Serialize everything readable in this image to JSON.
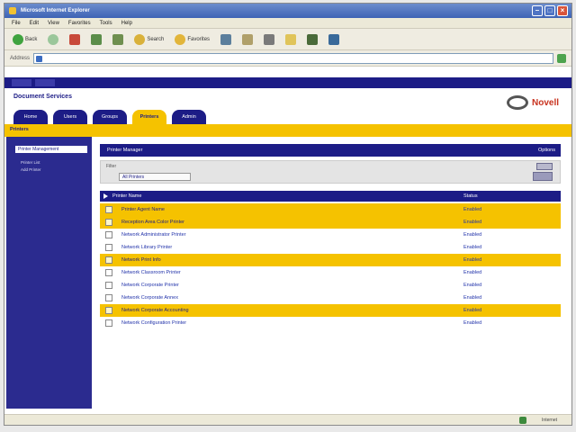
{
  "window": {
    "title": "Microsoft Internet Explorer"
  },
  "menu": [
    "File",
    "Edit",
    "View",
    "Favorites",
    "Tools",
    "Help"
  ],
  "toolbar": {
    "back": "Back",
    "search": "Search",
    "favorites": "Favorites"
  },
  "address": {
    "label": "Address"
  },
  "app": {
    "title": "Document Services",
    "logo_text": "Novell",
    "tabs": [
      "Home",
      "Users",
      "Groups",
      "Printers",
      "Admin"
    ],
    "active_tab": 3,
    "breadcrumb": "Printers"
  },
  "sidebar": {
    "heading": "Printer Management",
    "links": [
      "Printer List",
      "Add Printer"
    ]
  },
  "panel": {
    "title": "Printer Manager",
    "right_label": "Options",
    "filter_label": "Filter",
    "filter_value": "All Printers"
  },
  "list": {
    "col_name": "Printer Name",
    "col_status": "Status",
    "rows": [
      {
        "name": "Printer Agent Name",
        "status": "Enabled",
        "highlight": true
      },
      {
        "name": "Reception Area Color Printer",
        "status": "Enabled",
        "highlight": true
      },
      {
        "name": "Network Administrator Printer",
        "status": "Enabled",
        "highlight": false
      },
      {
        "name": "Network Library Printer",
        "status": "Enabled",
        "highlight": false
      },
      {
        "name": "Network Print Info",
        "status": "Enabled",
        "highlight": true
      },
      {
        "name": "Network Classroom Printer",
        "status": "Enabled",
        "highlight": false
      },
      {
        "name": "Network Corporate Printer",
        "status": "Enabled",
        "highlight": false
      },
      {
        "name": "Network Corporate Annex",
        "status": "Enabled",
        "highlight": false
      },
      {
        "name": "Network Corporate Accounting",
        "status": "Enabled",
        "highlight": true
      },
      {
        "name": "Network Configuration Printer",
        "status": "Enabled",
        "highlight": false
      }
    ]
  },
  "status": {
    "zone": "Internet"
  },
  "colors": {
    "navy": "#1c1c86",
    "yellow": "#f5c200",
    "accent_red": "#c8321e"
  }
}
